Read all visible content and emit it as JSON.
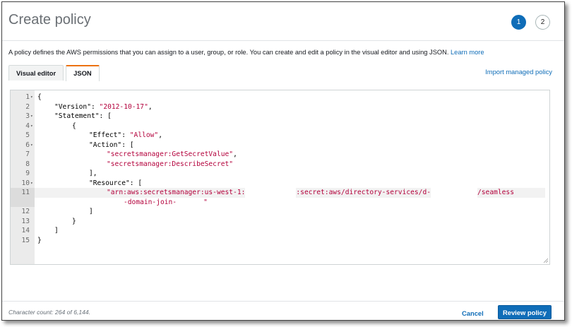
{
  "page": {
    "title": "Create policy",
    "steps": [
      "1",
      "2"
    ],
    "active_step": 1,
    "description": "A policy defines the AWS permissions that you can assign to a user, group, or role. You can create and edit a policy in the visual editor and using JSON.",
    "learn_more": "Learn more"
  },
  "tabs": [
    {
      "label": "Visual editor",
      "active": false
    },
    {
      "label": "JSON",
      "active": true
    }
  ],
  "import_link": "Import managed policy",
  "editor": {
    "line_numbers": [
      "1",
      "2",
      "3",
      "4",
      "5",
      "6",
      "7",
      "8",
      "9",
      "10",
      "11",
      "12",
      "13",
      "14",
      "15"
    ],
    "lines": {
      "l1": "{",
      "l2_key": "\"Version\"",
      "l2_val": "\"2012-10-17\"",
      "l3_key": "\"Statement\"",
      "l3_rest": ": [",
      "l4": "{",
      "l5_key": "\"Effect\"",
      "l5_val": "\"Allow\"",
      "l6_key": "\"Action\"",
      "l6_rest": ": [",
      "l7_val": "\"secretsmanager:GetSecretValue\"",
      "l8_val": "\"secretsmanager:DescribeSecret\"",
      "l9": "],",
      "l10_key": "\"Resource\"",
      "l10_rest": ": [",
      "l11_a": "\"arn:aws:secretsmanager:us-west-1:",
      "l11_b": ":secret:aws/directory-services/d-",
      "l11_c": "/seamless",
      "l11_d": "-domain-join-",
      "l11_e": "\"",
      "l12": "]",
      "l13": "}",
      "l14": "]",
      "l15": "}"
    }
  },
  "footer": {
    "char_count": "Character count: 264 of 6,144.",
    "cancel": "Cancel",
    "review": "Review policy"
  },
  "colors": {
    "accent": "#0f6db8",
    "string": "#b3003b",
    "tab_active_border": "#ec7211"
  }
}
